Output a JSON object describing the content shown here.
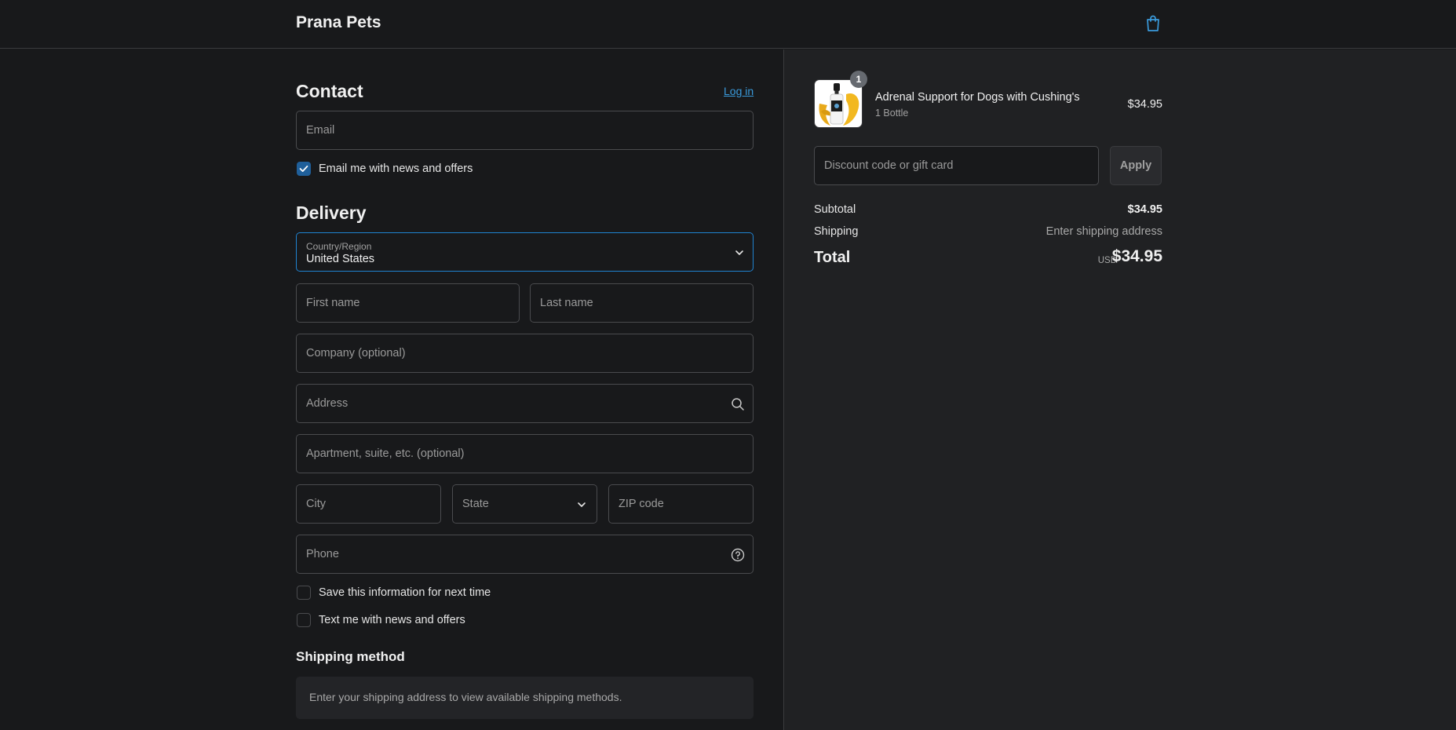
{
  "header": {
    "brand": "Prana Pets"
  },
  "contact": {
    "title": "Contact",
    "login_link": "Log in",
    "email_placeholder": "Email",
    "news_checkbox_label": "Email me with news and offers"
  },
  "delivery": {
    "title": "Delivery",
    "country_label": "Country/Region",
    "country_value": "United States",
    "first_name_placeholder": "First name",
    "last_name_placeholder": "Last name",
    "company_placeholder": "Company (optional)",
    "address_placeholder": "Address",
    "apartment_placeholder": "Apartment, suite, etc. (optional)",
    "city_placeholder": "City",
    "state_placeholder": "State",
    "zip_placeholder": "ZIP code",
    "phone_placeholder": "Phone",
    "save_info_label": "Save this information for next time",
    "text_me_label": "Text me with news and offers"
  },
  "shipping_method": {
    "title": "Shipping method",
    "message": "Enter your shipping address to view available shipping methods."
  },
  "order": {
    "item": {
      "quantity_badge": "1",
      "name": "Adrenal Support for Dogs with Cushing's",
      "variant": "1 Bottle",
      "price": "$34.95"
    },
    "discount_placeholder": "Discount code or gift card",
    "apply_label": "Apply",
    "subtotal_label": "Subtotal",
    "subtotal_value": "$34.95",
    "shipping_label": "Shipping",
    "shipping_value": "Enter shipping address",
    "total_label": "Total",
    "currency": "USD",
    "total_value": "$34.95"
  },
  "colors": {
    "accent": "#1f83d1",
    "link": "#3a9bdc",
    "background": "#18191b",
    "summary_background": "#202123"
  }
}
